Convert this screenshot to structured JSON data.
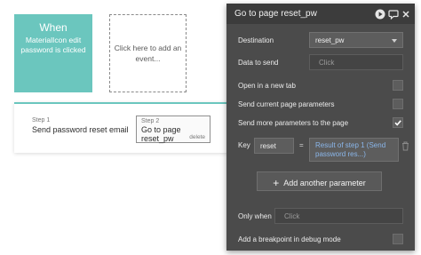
{
  "event": {
    "title": "When",
    "description": "MaterialIcon edit password is clicked"
  },
  "add_event": {
    "label": "Click here to add an event..."
  },
  "steps": [
    {
      "number": "Step 1",
      "name": "Send password reset email"
    },
    {
      "number": "Step 2",
      "name": "Go to page reset_pw",
      "delete_label": "delete"
    }
  ],
  "panel": {
    "title": "Go to page reset_pw",
    "destination_label": "Destination",
    "destination_value": "reset_pw",
    "data_to_send_label": "Data to send",
    "data_to_send_placeholder": "Click",
    "open_new_tab_label": "Open in a new tab",
    "send_current_params_label": "Send current page parameters",
    "send_more_params_label": "Send more parameters to the page",
    "send_more_params_checked": true,
    "key_label": "Key",
    "key_value": "reset",
    "equals": "=",
    "param_value": "Result of step 1 (Send password res...)",
    "add_param_label": "Add another parameter",
    "only_when_label": "Only when",
    "only_when_placeholder": "Click",
    "breakpoint_label": "Add a breakpoint in debug mode"
  },
  "colors": {
    "accent": "#6bc6be",
    "panel_bg": "#4b4b4b",
    "link_blue": "#8ab6ea"
  }
}
